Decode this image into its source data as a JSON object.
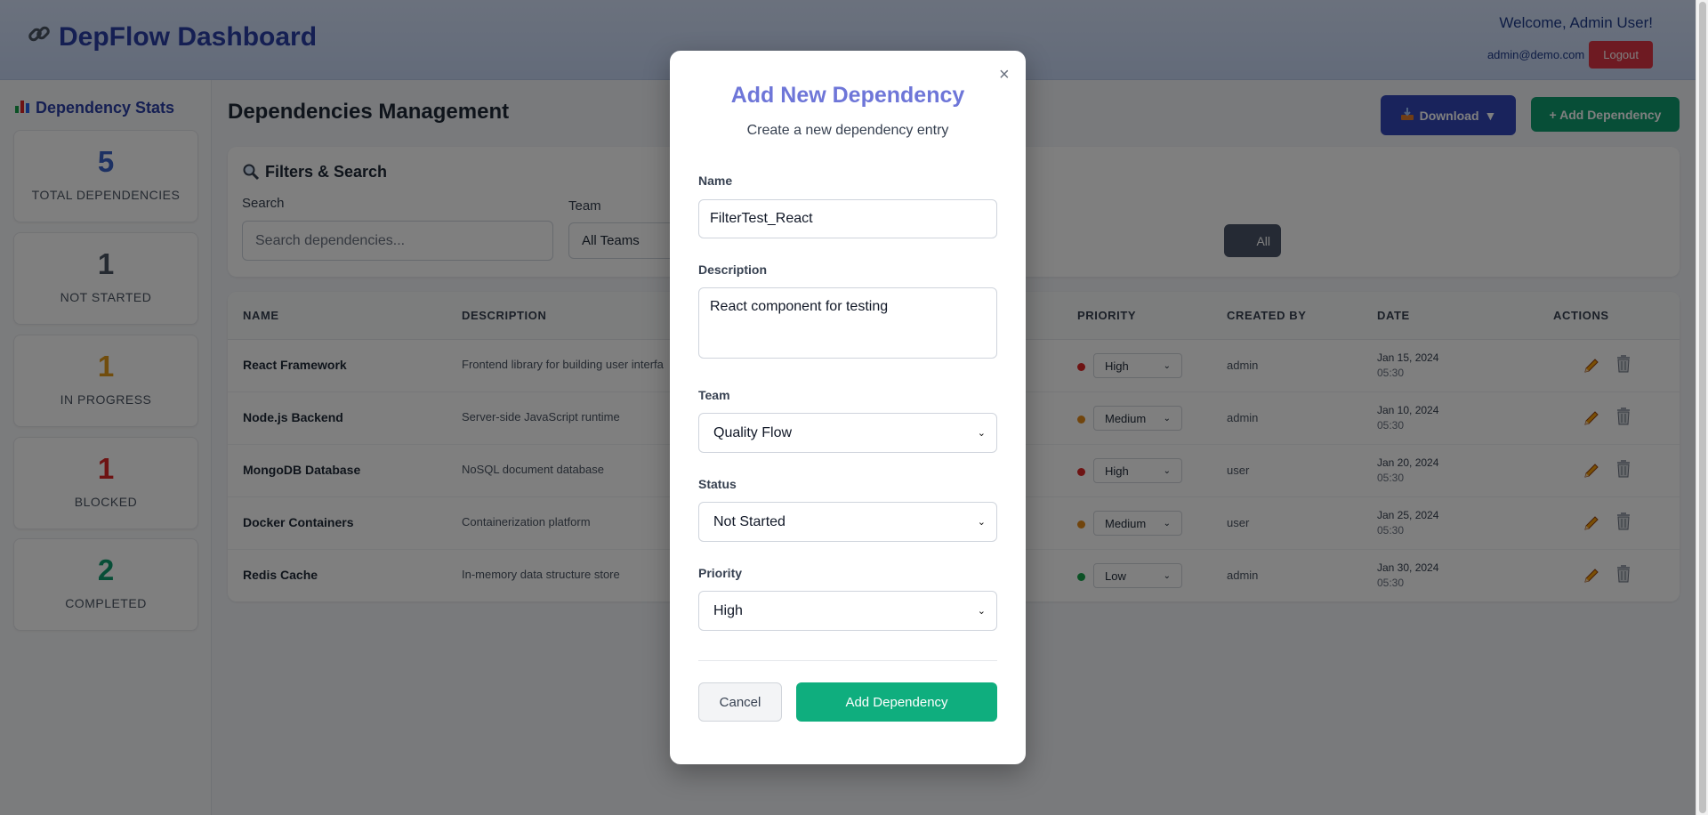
{
  "header": {
    "title": "DepFlow Dashboard",
    "welcome": "Welcome, Admin User!",
    "email": "admin@demo.com",
    "logout_label": "Logout"
  },
  "sidebar": {
    "title": "Dependency Stats",
    "stats": [
      {
        "value": "5",
        "label": "TOTAL DEPENDENCIES",
        "color": "#3a63c7"
      },
      {
        "value": "1",
        "label": "NOT STARTED",
        "color": "#4b5563"
      },
      {
        "value": "1",
        "label": "IN PROGRESS",
        "color": "#e39b1b"
      },
      {
        "value": "1",
        "label": "BLOCKED",
        "color": "#dc2626"
      },
      {
        "value": "2",
        "label": "COMPLETED",
        "color": "#0f9d6e"
      }
    ]
  },
  "main": {
    "title": "Dependencies Management",
    "download_label": "Download",
    "add_label": "+ Add Dependency"
  },
  "filters": {
    "title": "Filters & Search",
    "search_label": "Search",
    "search_placeholder": "Search dependencies...",
    "team_label": "Team",
    "team_value": "All Teams",
    "clear_label": "All"
  },
  "table": {
    "headers": [
      "NAME",
      "DESCRIPTION",
      "PRIORITY",
      "CREATED BY",
      "DATE",
      "ACTIONS"
    ],
    "rows": [
      {
        "name": "React Framework",
        "description": "Frontend library for building user interfa",
        "priority": "High",
        "priority_color": "#dc2626",
        "created_by": "admin",
        "date": "Jan 15, 2024",
        "time": "05:30"
      },
      {
        "name": "Node.js Backend",
        "description": "Server-side JavaScript runtime",
        "priority": "Medium",
        "priority_color": "#e38a1b",
        "created_by": "admin",
        "date": "Jan 10, 2024",
        "time": "05:30"
      },
      {
        "name": "MongoDB Database",
        "description": "NoSQL document database",
        "priority": "High",
        "priority_color": "#dc2626",
        "created_by": "user",
        "date": "Jan 20, 2024",
        "time": "05:30"
      },
      {
        "name": "Docker Containers",
        "description": "Containerization platform",
        "priority": "Medium",
        "priority_color": "#e38a1b",
        "created_by": "user",
        "date": "Jan 25, 2024",
        "time": "05:30"
      },
      {
        "name": "Redis Cache",
        "description": "In-memory data structure store",
        "priority": "Low",
        "priority_color": "#16a34a",
        "created_by": "admin",
        "date": "Jan 30, 2024",
        "time": "05:30"
      }
    ]
  },
  "modal": {
    "title": "Add New Dependency",
    "subtitle": "Create a new dependency entry",
    "name_label": "Name",
    "name_value": "FilterTest_React",
    "description_label": "Description",
    "description_value": "React component for testing",
    "team_label": "Team",
    "team_value": "Quality Flow",
    "status_label": "Status",
    "status_value": "Not Started",
    "priority_label": "Priority",
    "priority_value": "High",
    "cancel_label": "Cancel",
    "submit_label": "Add Dependency",
    "close_symbol": "×"
  }
}
